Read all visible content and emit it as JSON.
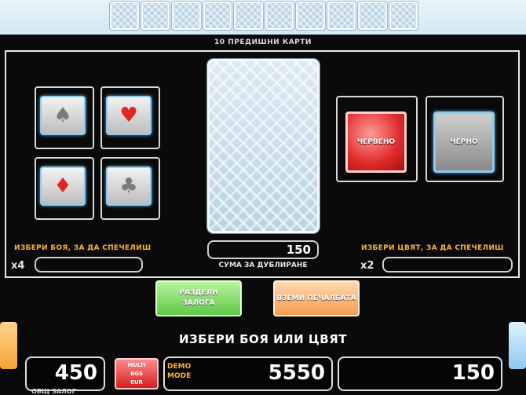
{
  "history": {
    "title": "10 ПРЕДИШНИ КАРТИ",
    "slots": 10
  },
  "suits": [
    {
      "name": "spade",
      "glyph": "♠",
      "color": "#7a7a7a"
    },
    {
      "name": "heart",
      "glyph": "♥",
      "color": "#e02525"
    },
    {
      "name": "diamond",
      "glyph": "♦",
      "color": "#e02525"
    },
    {
      "name": "club",
      "glyph": "♣",
      "color": "#7a7a7a"
    }
  ],
  "suit_section": {
    "label": "ИЗБЕРИ БОЯ, ЗА ДА СПЕЧЕЛИШ",
    "multiplier": "x4"
  },
  "color_section": {
    "red_label": "ЧЕРВЕНО",
    "black_label": "ЧЕРНО",
    "label": "ИЗБЕРИ ЦВЯТ, ЗА ДА СПЕЧЕЛИШ",
    "multiplier": "x2"
  },
  "double_amount": {
    "value": "150",
    "label": "СУМА ЗА ДУБЛИРАНЕ"
  },
  "buttons": {
    "split_line1": "РАЗДЕЛИ",
    "split_line2": "ЗАЛОГА",
    "collect_label": "ВЗЕМИ ПЕЧАЛБАТА"
  },
  "prompt": "ИЗБЕРИ БОЯ ИЛИ ЦВЯТ",
  "bottom_bar": {
    "bet_value": "450",
    "bet_label": "ОБЩ ЗАЛОГ",
    "currency_line1": "MULTI",
    "currency_line2": "BGS",
    "currency_line3": "EUR",
    "demo_line1": "DEMO",
    "demo_line2": "MODE",
    "credit_value": "5550",
    "win_value": "150"
  },
  "colors": {
    "gold": "#ffb23a",
    "red_button": "#e02a2a",
    "green_button": "#5ec94a",
    "orange_button": "#f39c52",
    "highlight_blue": "#8ec9f0"
  }
}
